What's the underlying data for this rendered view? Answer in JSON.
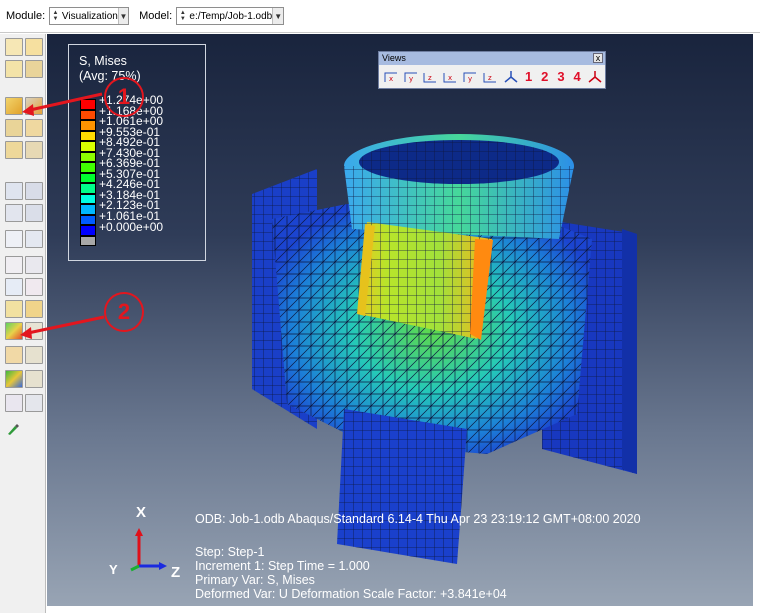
{
  "context_bar": {
    "module_label": "Module:",
    "module_value": "Visualization",
    "model_label": "Model:",
    "model_value": "e:/Temp/Job-1.odb"
  },
  "legend": {
    "title": "S, Mises",
    "avg": "(Avg: 75%)",
    "values": [
      "+1.274e+00",
      "+1.168e+00",
      "+1.061e+00",
      "+9.553e-01",
      "+8.492e-01",
      "+7.430e-01",
      "+6.369e-01",
      "+5.307e-01",
      "+4.246e-01",
      "+3.184e-01",
      "+2.123e-01",
      "+1.061e-01",
      "+0.000e+00"
    ],
    "colors": [
      "#ff0000",
      "#ff4a00",
      "#ff9400",
      "#ffdc00",
      "#d8ff00",
      "#8cff00",
      "#40ff00",
      "#00ff30",
      "#00ff8a",
      "#00ffe0",
      "#00b8ff",
      "#005cff",
      "#0000ff",
      "#a7a7a7"
    ]
  },
  "views_toolbar": {
    "title": "Views",
    "close": "x",
    "numbers": [
      "1",
      "2",
      "3",
      "4"
    ]
  },
  "info": {
    "odb": "ODB: Job-1.odb    Abaqus/Standard 6.14-4    Thu Apr 23 23:19:12 GMT+08:00 2020",
    "step": "Step: Step-1",
    "increment": "Increment      1: Step Time =      1.000",
    "primary": "Primary Var: S, Mises",
    "deformed": "Deformed Var: U   Deformation Scale Factor: +3.841e+04"
  },
  "triad": {
    "x": "X",
    "y": "Y",
    "z": "Z"
  },
  "annotations": {
    "one": "1",
    "two": "2"
  },
  "colors": {
    "annotation": "#e3161e",
    "mesh": "#0d1740"
  }
}
